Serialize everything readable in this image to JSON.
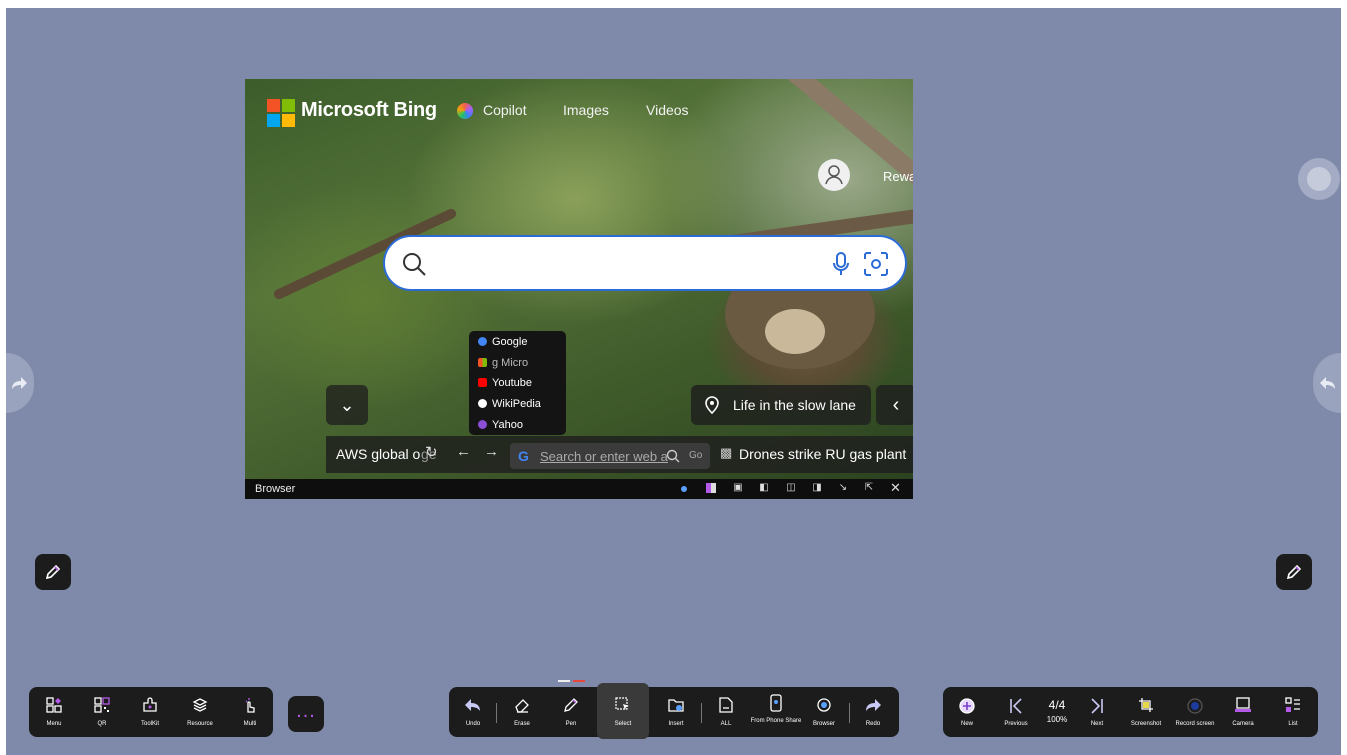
{
  "browser": {
    "brand": "Microsoft Bing",
    "nav": [
      "Copilot",
      "Images",
      "Videos"
    ],
    "rewards": "Rewa",
    "engines": [
      {
        "label": "Google",
        "icon": "google-icon",
        "color": "#4285f4"
      },
      {
        "label": "g     Micro",
        "icon": "microsoft-icon",
        "color": "#f35325"
      },
      {
        "label": "Youtube",
        "icon": "youtube-icon",
        "color": "#ff0000"
      },
      {
        "label": "WikiPedia",
        "icon": "wikipedia-icon",
        "color": "#ffffff"
      },
      {
        "label": "Yahoo",
        "icon": "yahoo-icon",
        "color": "#8a4fd6"
      }
    ],
    "caption": "Life in the slow lane",
    "news_left": "AWS global o",
    "news_left_tail": "ge",
    "news_right": "Drones strike RU gas plant",
    "address_placeholder": "Search or enter web a",
    "go_label": "Go",
    "status_title": "Browser"
  },
  "left_toolbar": [
    {
      "label": "Menu",
      "icon": "menu-icon"
    },
    {
      "label": "QR",
      "icon": "qr-icon"
    },
    {
      "label": "ToolKit",
      "icon": "toolkit-icon"
    },
    {
      "label": "Resource",
      "icon": "resource-icon"
    },
    {
      "label": "Multi",
      "icon": "multi-touch-icon"
    }
  ],
  "more_label": "...",
  "center_toolbar": [
    {
      "label": "Undo",
      "icon": "undo-icon"
    },
    {
      "label": "Erase",
      "icon": "eraser-icon"
    },
    {
      "label": "Pen",
      "icon": "pen-icon"
    },
    {
      "label": "Select",
      "icon": "select-icon",
      "active": true
    },
    {
      "label": "Insert",
      "icon": "insert-icon"
    },
    {
      "label": "ALL",
      "icon": "document-icon"
    },
    {
      "label": "From Phone Share",
      "icon": "phone-share-icon"
    },
    {
      "label": "Browser",
      "icon": "browser-icon"
    },
    {
      "label": "Redo",
      "icon": "redo-icon"
    }
  ],
  "right_toolbar": {
    "new_label": "New",
    "previous_label": "Previous",
    "page": "4/4",
    "zoom": "100%",
    "next_label": "Next",
    "screenshot_label": "Screenshot",
    "record_label": "Record screen",
    "camera_label": "Camera",
    "list_label": "List"
  },
  "colors": {
    "desk": "#7f8aaa",
    "toolbar": "#1c1c1c",
    "accent": "#b45ae8",
    "search_border": "#2c6bd6"
  }
}
